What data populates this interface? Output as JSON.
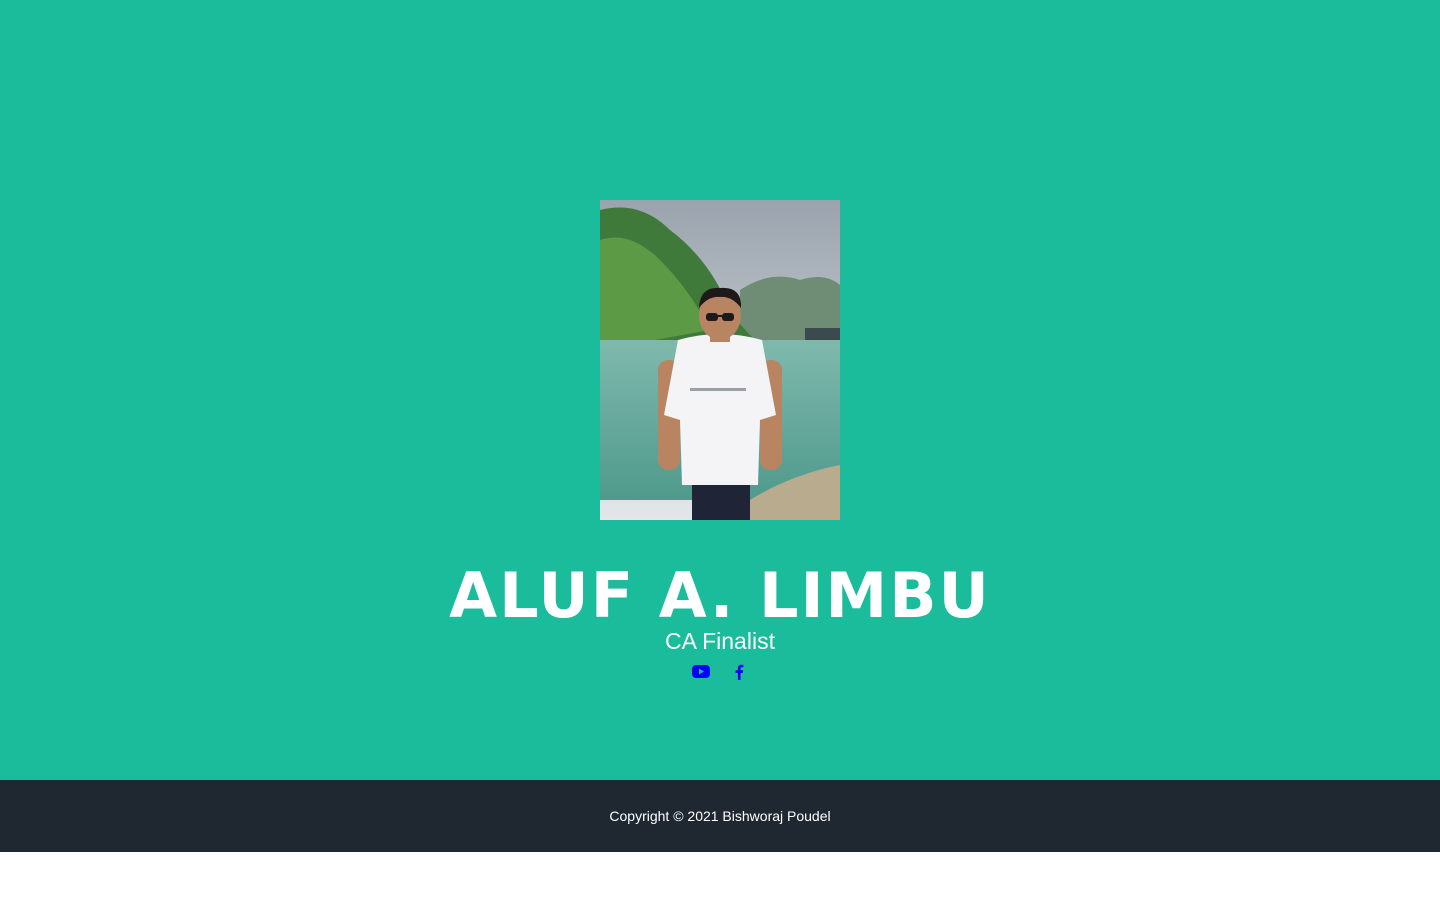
{
  "profile": {
    "name": "ALUF A. LIMBU",
    "role": "CA Finalist",
    "photo_alt": "profile-photo"
  },
  "social": [
    {
      "icon": "youtube-icon",
      "label": "YouTube"
    },
    {
      "icon": "facebook-icon",
      "label": "Facebook"
    }
  ],
  "footer": {
    "copyright": "Copyright © 2021 Bishworaj Poudel"
  },
  "colors": {
    "hero_background": "#1abc9c",
    "footer_background": "#1f2731",
    "icon_color": "#0000ff",
    "text_color": "#ffffff"
  }
}
